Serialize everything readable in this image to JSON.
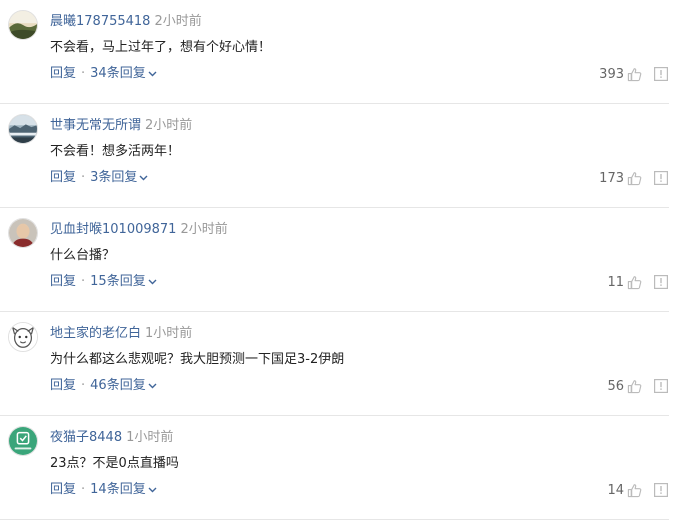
{
  "comments": [
    {
      "username": "晨曦178755418",
      "time": "2小时前",
      "text": "不会看，马上过年了，想有个好心情！",
      "reply_label": "回复",
      "replies_label": "34条回复",
      "likes": "393",
      "avatar_icon": "landscape-avatar-icon"
    },
    {
      "username": "世事无常无所谓",
      "time": "2小时前",
      "text": "不会看！想多活两年！",
      "reply_label": "回复",
      "replies_label": "3条回复",
      "likes": "173",
      "avatar_icon": "scenery-avatar-icon"
    },
    {
      "username": "见血封喉101009871",
      "time": "2小时前",
      "text": "什么台播？",
      "reply_label": "回复",
      "replies_label": "15条回复",
      "likes": "11",
      "avatar_icon": "portrait-avatar-icon"
    },
    {
      "username": "地主家的老亿白",
      "time": "1小时前",
      "text": "为什么都这么悲观呢？我大胆预测一下国足3-2伊朗",
      "reply_label": "回复",
      "replies_label": "46条回复",
      "likes": "56",
      "avatar_icon": "cartoon-avatar-icon"
    },
    {
      "username": "夜猫子8448",
      "time": "1小时前",
      "text": "23点？不是0点直播吗",
      "reply_label": "回复",
      "replies_label": "14条回复",
      "likes": "14",
      "avatar_icon": "app-logo-avatar-icon"
    }
  ],
  "separator": "·",
  "colors": {
    "username": "#406599",
    "time": "#999999",
    "text": "#222222",
    "divider": "#e6e6e6"
  }
}
